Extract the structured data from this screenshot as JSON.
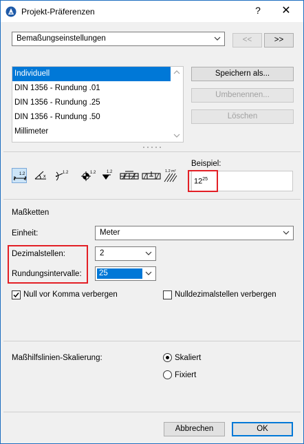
{
  "window": {
    "title": "Projekt-Präferenzen",
    "help_glyph": "?",
    "close_glyph": "✕"
  },
  "header": {
    "category_select": "Bemaßungseinstellungen",
    "prev_label": "<<",
    "next_label": ">>"
  },
  "presets": {
    "items": [
      {
        "label": "Individuell",
        "selected": true
      },
      {
        "label": "DIN 1356 - Rundung .01",
        "selected": false
      },
      {
        "label": "DIN 1356 - Rundung .25",
        "selected": false
      },
      {
        "label": "DIN 1356 - Rundung .50",
        "selected": false
      },
      {
        "label": "Millimeter",
        "selected": false
      }
    ],
    "save_as_label": "Speichern als...",
    "rename_label": "Umbenennen...",
    "delete_label": "Löschen"
  },
  "dimension_tools": {
    "icons": [
      "linear-dimension-icon",
      "angle-dimension-icon",
      "radial-dimension-icon",
      "level-dimension-icon",
      "elevation-dimension-icon",
      "door-window-dimension-icon",
      "sill-height-dimension-icon",
      "area-dimension-icon"
    ],
    "tool_labels": [
      "1.2",
      "x",
      "1.2",
      "1.2",
      "1.2",
      "",
      "",
      "1.2 m²"
    ],
    "example_label": "Beispiel:",
    "example_main": "12",
    "example_sup": "25"
  },
  "chains": {
    "section_title": "Maßketten",
    "unit_label": "Einheit:",
    "unit_value": "Meter",
    "decimals_label": "Dezimalstellen:",
    "decimals_value": "2",
    "rounding_label": "Rundungsintervalle:",
    "rounding_value": "25",
    "hide_zero_label": "Null vor Komma verbergen",
    "hide_zero_checked": true,
    "hide_zero_decimals_label": "Nulldezimalstellen verbergen",
    "hide_zero_decimals_checked": false
  },
  "scaling": {
    "label": "Maßhilfslinien-Skalierung:",
    "option_scaled": "Skaliert",
    "option_fixed": "Fixiert",
    "selected": "Skaliert"
  },
  "footer": {
    "cancel_label": "Abbrechen",
    "ok_label": "OK"
  },
  "colors": {
    "accent": "#0078d7",
    "highlight_box": "#e31e24"
  }
}
